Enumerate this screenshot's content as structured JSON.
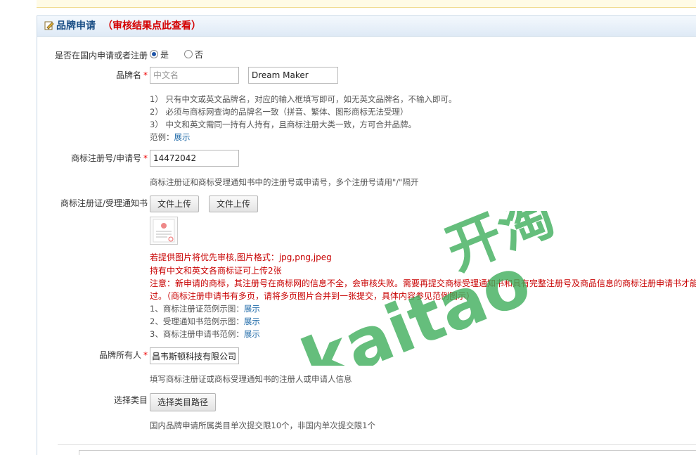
{
  "panel": {
    "title": "品牌申请",
    "title_link": "（审核结果点此查看）"
  },
  "domestic": {
    "label": "是否在国内申请或者注册",
    "yes": "是",
    "no": "否"
  },
  "brand_name": {
    "label": "品牌名",
    "cn_placeholder": "中文名",
    "en_value": "Dream Maker",
    "tips": [
      "1） 只有中文或英文品牌名，对应的输入框填写即可，如无英文品牌名，不输入即可。",
      "2） 必须与商标网查询的品牌名一致（拼音、繁体、图形商标无法受理）",
      "3） 中文和英文需同一持有人持有，且商标注册大类一致，方可合并品牌。"
    ],
    "example_label": "范例：",
    "example_link": "展示"
  },
  "trademark_no": {
    "label": "商标注册号/申请号",
    "value": "14472042",
    "tip": "商标注册证和商标受理通知书中的注册号或申请号，多个注册号请用\"/\"隔开"
  },
  "certificate": {
    "label": "商标注册证/受理通知书",
    "upload_label": "文件上传",
    "notes": [
      "若提供图片将优先审核,图片格式：jpg,png,jpeg",
      "持有中文和英文各商标证可上传2张",
      "注意：新申请的商标，其注册号在商标网的信息不全，会审核失败。需要再提交商标受理通知书和具有完整注册号及商品信息的商标注册申请书才能",
      "过。（商标注册申请书有多页，请将多页图片合并到一张提交，具体内容参见范例图示）"
    ],
    "examples": [
      {
        "label": "1、商标注册证范例示图：",
        "link": "展示"
      },
      {
        "label": "2、受理通知书范例示图：",
        "link": "展示"
      },
      {
        "label": "3、商标注册申请书范例：",
        "link": "展示"
      }
    ]
  },
  "owner": {
    "label": "品牌所有人",
    "value": "昌韦斯顿科技有限公司",
    "tip": "填写商标注册证或商标受理通知书的注册人或申请人信息"
  },
  "category": {
    "label": "选择类目",
    "button": "选择类目路径",
    "tip": "国内品牌申请所属类目单次提交限10个，非国内单次提交限1个"
  },
  "watermark": {
    "text": "kaitao",
    "cn": "开淘"
  },
  "colors": {
    "title_blue": "#1b4f86",
    "link_blue": "#1f6aa8",
    "note_red": "#c80000",
    "watermark_green": "#3fae5c"
  }
}
